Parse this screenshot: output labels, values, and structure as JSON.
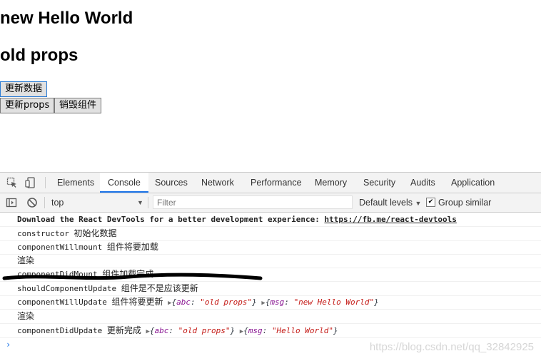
{
  "page": {
    "title": "new Hello World",
    "props_heading": "old props",
    "buttons": {
      "update_data": "更新数据",
      "update_props": "更新props",
      "destroy": "销毁组件"
    }
  },
  "devtools": {
    "tabs": [
      "Elements",
      "Console",
      "Sources",
      "Network",
      "Performance",
      "Memory",
      "Security",
      "Audits",
      "Application"
    ],
    "active_tab": "Console",
    "toolbar": {
      "context": "top",
      "filter_placeholder": "Filter",
      "levels": "Default levels",
      "group_similar": "Group similar"
    },
    "messages": [
      {
        "text": "Download the React DevTools for a better development experience: ",
        "link": "https://fb.me/react-devtools"
      },
      {
        "code": "constructor",
        "cn": "初始化数据"
      },
      {
        "code": "componentWillmount",
        "cn": "组件将要加载"
      },
      {
        "cn": "渲染"
      },
      {
        "code": "componentDidMount",
        "cn": "组件加载完成"
      },
      {
        "code": "shouldComponentUpdate",
        "cn": "组件是不是应该更新"
      },
      {
        "code": "componentWillUpdate",
        "cn": "组件将要更新",
        "arg1": {
          "key": "abc",
          "value": "\"old props\""
        },
        "arg2": {
          "key": "msg",
          "value": "\"new Hello World\""
        }
      },
      {
        "cn": "渲染"
      },
      {
        "code": "componentDidUpdate",
        "cn": "更新完成",
        "arg1": {
          "key": "abc",
          "value": "\"old props\""
        },
        "arg2": {
          "key": "msg",
          "value": "\"Hello World\""
        }
      }
    ],
    "prompt": "›"
  },
  "watermark": "https://blog.csdn.net/qq_32842925",
  "colors": {
    "accent": "#1a73e8",
    "string": "#c41a16",
    "key": "#881391"
  }
}
